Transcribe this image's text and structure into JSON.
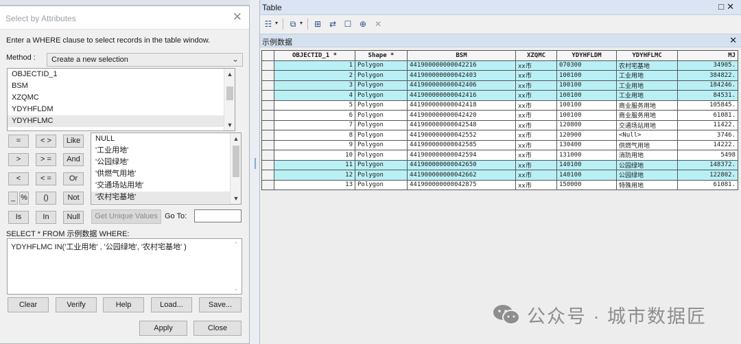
{
  "dialog": {
    "title": "Select by Attributes",
    "instruction": "Enter a WHERE clause to select records in the table window.",
    "method_label": "Method :",
    "method_value": "Create a new selection",
    "fields": [
      "OBJECTID_1",
      "BSM",
      "XZQMC",
      "YDYHFLDM",
      "YDYHFLMC"
    ],
    "selected_field": "YDYHFLMC",
    "operators": {
      "eq": "=",
      "ne": "< >",
      "like": "Like",
      "gt": ">",
      "ge": "> =",
      "and": "And",
      "lt": "<",
      "le": "< =",
      "or": "Or",
      "underscore": "_",
      "percent": "%",
      "paren": "()",
      "not": "Not",
      "is": "Is",
      "in": "In",
      "null": "Null"
    },
    "values": [
      "NULL",
      "'工业用地'",
      "'公园绿地'",
      "'供燃气用地'",
      "'交通场站用地'",
      "'农村宅基地'"
    ],
    "selected_value": "'农村宅基地'",
    "get_unique_label": "Get Unique Values",
    "goto_label": "Go To:",
    "select_from_label": "SELECT * FROM 示例数据 WHERE:",
    "where_clause": "YDYHFLMC IN('工业用地' , '公园绿地', '农村宅基地' )",
    "buttons": {
      "clear": "Clear",
      "verify": "Verify",
      "help": "Help",
      "load": "Load...",
      "save": "Save...",
      "apply": "Apply",
      "close": "Close"
    }
  },
  "table_window": {
    "title": "Table",
    "tab_label": "示例数据",
    "columns": [
      "OBJECTID_1 *",
      "Shape *",
      "BSM",
      "XZQMC",
      "YDYHFLDM",
      "YDYHFLMC",
      "MJ"
    ],
    "rows": [
      {
        "id": "1",
        "shape": "Polygon",
        "bsm": "441900000000042216",
        "xzqmc": "xx市",
        "dm": "070300",
        "mc": "农村宅基地",
        "mj": "34905.",
        "selected": true
      },
      {
        "id": "2",
        "shape": "Polygon",
        "bsm": "441900000000042403",
        "xzqmc": "xx市",
        "dm": "100100",
        "mc": "工业用地",
        "mj": "384822.",
        "selected": true
      },
      {
        "id": "3",
        "shape": "Polygon",
        "bsm": "441900000000042406",
        "xzqmc": "xx市",
        "dm": "100100",
        "mc": "工业用地",
        "mj": "184246.",
        "selected": true
      },
      {
        "id": "4",
        "shape": "Polygon",
        "bsm": "441900000000042416",
        "xzqmc": "xx市",
        "dm": "100100",
        "mc": "工业用地",
        "mj": "84531.",
        "selected": true
      },
      {
        "id": "5",
        "shape": "Polygon",
        "bsm": "441900000000042418",
        "xzqmc": "xx市",
        "dm": "100100",
        "mc": "商业服务用地",
        "mj": "105845.",
        "selected": false
      },
      {
        "id": "6",
        "shape": "Polygon",
        "bsm": "441900000000042420",
        "xzqmc": "xx市",
        "dm": "100100",
        "mc": "商业服务用地",
        "mj": "61081.",
        "selected": false
      },
      {
        "id": "7",
        "shape": "Polygon",
        "bsm": "441900000000042548",
        "xzqmc": "xx市",
        "dm": "120800",
        "mc": "交通场站用地",
        "mj": "11422.",
        "selected": false
      },
      {
        "id": "8",
        "shape": "Polygon",
        "bsm": "441900000000042552",
        "xzqmc": "xx市",
        "dm": "120900",
        "mc": "<Null>",
        "mj": "3746.",
        "selected": false
      },
      {
        "id": "9",
        "shape": "Polygon",
        "bsm": "441900000000042585",
        "xzqmc": "xx市",
        "dm": "130400",
        "mc": "供燃气用地",
        "mj": "14222.",
        "selected": false
      },
      {
        "id": "10",
        "shape": "Polygon",
        "bsm": "441900000000042594",
        "xzqmc": "xx市",
        "dm": "131000",
        "mc": "消防用地",
        "mj": "5498",
        "selected": false
      },
      {
        "id": "11",
        "shape": "Polygon",
        "bsm": "441900000000042650",
        "xzqmc": "xx市",
        "dm": "140100",
        "mc": "公园绿地",
        "mj": "148372.",
        "selected": true
      },
      {
        "id": "12",
        "shape": "Polygon",
        "bsm": "441900000000042662",
        "xzqmc": "xx市",
        "dm": "140100",
        "mc": "公园绿地",
        "mj": "122802.",
        "selected": true
      },
      {
        "id": "13",
        "shape": "Polygon",
        "bsm": "441900000000042875",
        "xzqmc": "xx市",
        "dm": "150000",
        "mc": "特殊用地",
        "mj": "61081.",
        "selected": false
      }
    ]
  },
  "watermark": {
    "text": "公众号 · 城市数据匠"
  },
  "colors": {
    "selected_row": "#b9f0f6",
    "title_bar": "#dbe4f2"
  }
}
